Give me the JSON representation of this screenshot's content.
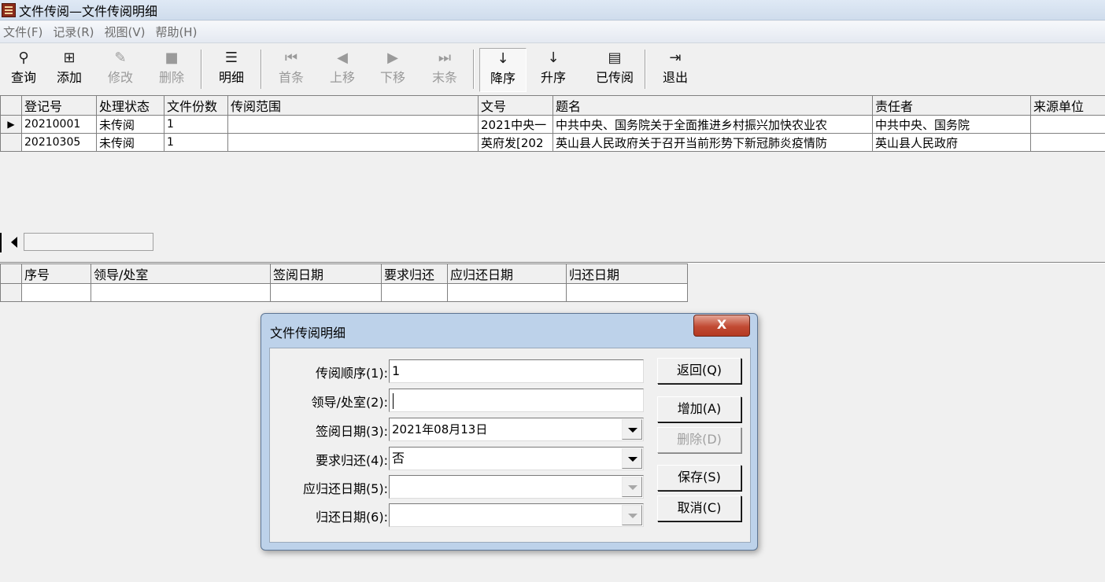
{
  "window": {
    "title": "文件传阅—文件传阅明细"
  },
  "menu": [
    "文件(F)",
    "记录(R)",
    "视图(V)",
    "帮助(H)"
  ],
  "toolbar": {
    "query": "查询",
    "add": "添加",
    "edit": "修改",
    "delete": "删除",
    "detail": "明细",
    "first": "首条",
    "prev": "上移",
    "next": "下移",
    "last": "末条",
    "desc": "降序",
    "asc": "升序",
    "circulated": "已传阅",
    "exit": "退出"
  },
  "main_table": {
    "headers": [
      "登记号",
      "处理状态",
      "文件份数",
      "传阅范围",
      "文号",
      "题名",
      "责任者",
      "来源单位"
    ],
    "rows": [
      [
        "20210001",
        "未传阅",
        "1",
        "",
        "2021中央一",
        "中共中央、国务院关于全面推进乡村振兴加快农业农",
        "中共中央、国务院",
        ""
      ],
      [
        "20210305",
        "未传阅",
        "1",
        "",
        "英府发[202",
        "英山县人民政府关于召开当前形势下新冠肺炎疫情防",
        "英山县人民政府",
        ""
      ]
    ]
  },
  "detail_table": {
    "headers": [
      "序号",
      "领导/处室",
      "签阅日期",
      "要求归还",
      "应归还日期",
      "归还日期"
    ]
  },
  "dialog": {
    "title": "文件传阅明细",
    "close": "X",
    "fields": {
      "order_label": "传阅顺序(1):",
      "order_value": "1",
      "leader_label": "领导/处室(2):",
      "leader_value": "",
      "sign_date_label": "签阅日期(3):",
      "sign_date_value": "2021年08月13日",
      "require_return_label": "要求归还(4):",
      "require_return_value": "否",
      "due_date_label": "应归还日期(5):",
      "due_date_value": "",
      "return_date_label": "归还日期(6):",
      "return_date_value": ""
    },
    "buttons": {
      "back": "返回(Q)",
      "add": "增加(A)",
      "delete": "删除(D)",
      "save": "保存(S)",
      "cancel": "取消(C)"
    }
  }
}
